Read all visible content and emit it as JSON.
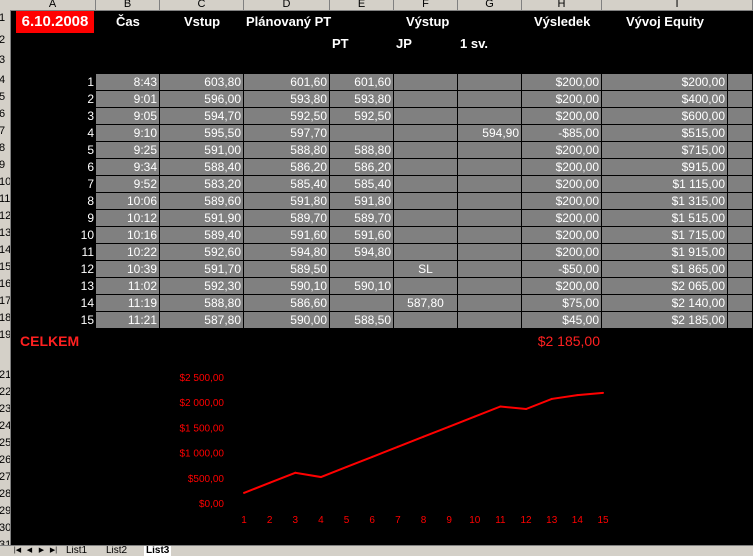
{
  "columns": [
    "A",
    "B",
    "C",
    "D",
    "E",
    "F",
    "G",
    "H",
    "I"
  ],
  "row_numbers": [
    "1",
    "2",
    "3",
    "4",
    "5",
    "6",
    "7",
    "8",
    "9",
    "10",
    "11",
    "12",
    "13",
    "14",
    "15",
    "16",
    "17",
    "18",
    "19",
    "21",
    "22",
    "23",
    "24",
    "25",
    "26",
    "27",
    "28",
    "29",
    "30",
    "31"
  ],
  "header": {
    "date": "6.10.2008",
    "cas": "Čas",
    "vstup": "Vstup",
    "planovany_pt": "Plánovaný PT",
    "vystup": "Výstup",
    "vysledek": "Výsledek",
    "vyvoj_equity": "Vývoj Equity",
    "sub_pt": "PT",
    "sub_jp": "JP",
    "sub_1sv": "1 sv."
  },
  "trades": [
    {
      "n": "1",
      "time": "8:43",
      "vstup": "603,80",
      "plan": "601,60",
      "pt": "601,60",
      "jp": "",
      "sv": "",
      "vysledek": "$200,00",
      "equity": "$200,00"
    },
    {
      "n": "2",
      "time": "9:01",
      "vstup": "596,00",
      "plan": "593,80",
      "pt": "593,80",
      "jp": "",
      "sv": "",
      "vysledek": "$200,00",
      "equity": "$400,00"
    },
    {
      "n": "3",
      "time": "9:05",
      "vstup": "594,70",
      "plan": "592,50",
      "pt": "592,50",
      "jp": "",
      "sv": "",
      "vysledek": "$200,00",
      "equity": "$600,00"
    },
    {
      "n": "4",
      "time": "9:10",
      "vstup": "595,50",
      "plan": "597,70",
      "pt": "",
      "jp": "",
      "sv": "594,90",
      "vysledek": "-$85,00",
      "equity": "$515,00"
    },
    {
      "n": "5",
      "time": "9:25",
      "vstup": "591,00",
      "plan": "588,80",
      "pt": "588,80",
      "jp": "",
      "sv": "",
      "vysledek": "$200,00",
      "equity": "$715,00"
    },
    {
      "n": "6",
      "time": "9:34",
      "vstup": "588,40",
      "plan": "586,20",
      "pt": "586,20",
      "jp": "",
      "sv": "",
      "vysledek": "$200,00",
      "equity": "$915,00"
    },
    {
      "n": "7",
      "time": "9:52",
      "vstup": "583,20",
      "plan": "585,40",
      "pt": "585,40",
      "jp": "",
      "sv": "",
      "vysledek": "$200,00",
      "equity": "$1 115,00"
    },
    {
      "n": "8",
      "time": "10:06",
      "vstup": "589,60",
      "plan": "591,80",
      "pt": "591,80",
      "jp": "",
      "sv": "",
      "vysledek": "$200,00",
      "equity": "$1 315,00"
    },
    {
      "n": "9",
      "time": "10:12",
      "vstup": "591,90",
      "plan": "589,70",
      "pt": "589,70",
      "jp": "",
      "sv": "",
      "vysledek": "$200,00",
      "equity": "$1 515,00"
    },
    {
      "n": "10",
      "time": "10:16",
      "vstup": "589,40",
      "plan": "591,60",
      "pt": "591,60",
      "jp": "",
      "sv": "",
      "vysledek": "$200,00",
      "equity": "$1 715,00"
    },
    {
      "n": "11",
      "time": "10:22",
      "vstup": "592,60",
      "plan": "594,80",
      "pt": "594,80",
      "jp": "",
      "sv": "",
      "vysledek": "$200,00",
      "equity": "$1 915,00"
    },
    {
      "n": "12",
      "time": "10:39",
      "vstup": "591,70",
      "plan": "589,50",
      "pt": "",
      "jp": "SL",
      "sv": "",
      "vysledek": "-$50,00",
      "equity": "$1 865,00"
    },
    {
      "n": "13",
      "time": "11:02",
      "vstup": "592,30",
      "plan": "590,10",
      "pt": "590,10",
      "jp": "",
      "sv": "",
      "vysledek": "$200,00",
      "equity": "$2 065,00"
    },
    {
      "n": "14",
      "time": "11:19",
      "vstup": "588,80",
      "plan": "586,60",
      "pt": "",
      "jp": "587,80",
      "sv": "",
      "vysledek": "$75,00",
      "equity": "$2 140,00"
    },
    {
      "n": "15",
      "time": "11:21",
      "vstup": "587,80",
      "plan": "590,00",
      "pt": "588,50",
      "jp": "",
      "sv": "",
      "vysledek": "$45,00",
      "equity": "$2 185,00"
    }
  ],
  "total": {
    "label": "CELKEM",
    "value": "$2 185,00"
  },
  "chart_data": {
    "type": "line",
    "x": [
      1,
      2,
      3,
      4,
      5,
      6,
      7,
      8,
      9,
      10,
      11,
      12,
      13,
      14,
      15
    ],
    "series": [
      {
        "values": [
          200,
          400,
          600,
          515,
          715,
          915,
          1115,
          1315,
          1515,
          1715,
          1915,
          1865,
          2065,
          2140,
          2185
        ]
      }
    ],
    "y_tick_labels": [
      "$0,00",
      "$500,00",
      "$1 000,00",
      "$1 500,00",
      "$2 000,00",
      "$2 500,00"
    ],
    "y_ticks": [
      0,
      500,
      1000,
      1500,
      2000,
      2500
    ],
    "ylim": [
      0,
      2500
    ],
    "color": "#ff0000",
    "grid": false
  },
  "tabs": [
    "List1",
    "List2",
    "List3"
  ],
  "active_tab": "List3"
}
